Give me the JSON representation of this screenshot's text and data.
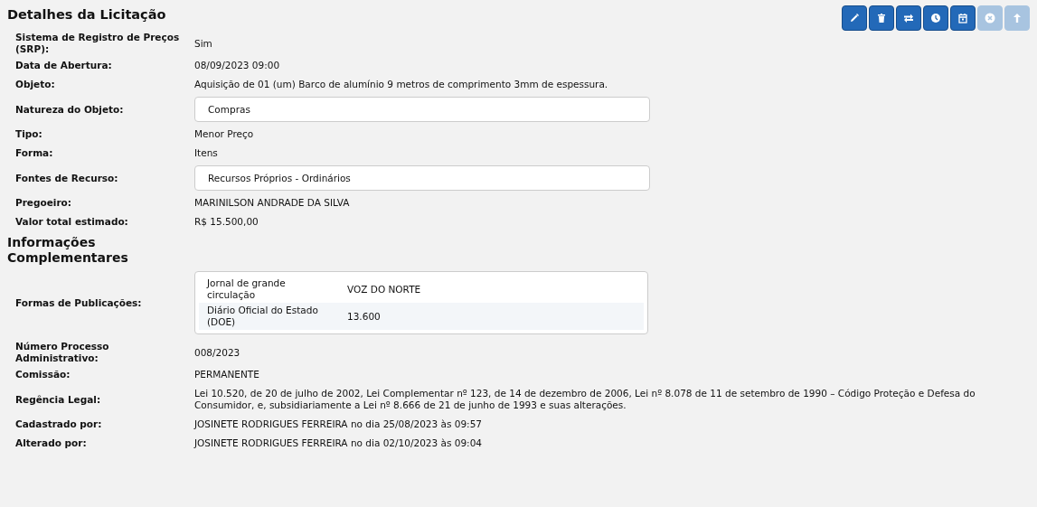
{
  "title": "Detalhes da Licitação",
  "toolbar": [
    {
      "kind": "pencil",
      "disabled": false
    },
    {
      "kind": "trash",
      "disabled": false
    },
    {
      "kind": "swap",
      "disabled": false
    },
    {
      "kind": "clock",
      "disabled": false
    },
    {
      "kind": "calendar",
      "disabled": false
    },
    {
      "kind": "cancel",
      "disabled": true
    },
    {
      "kind": "up",
      "disabled": true
    }
  ],
  "sections": [
    {
      "rows": [
        {
          "kind": "text",
          "label": "Sistema de Registro de Preços (SRP):",
          "value": "Sim"
        },
        {
          "kind": "text",
          "label": "Data de Abertura:",
          "value": "08/09/2023 09:00"
        },
        {
          "kind": "text",
          "label": "Objeto:",
          "value": "Aquisição de 01 (um) Barco de alumínio 9 metros de comprimento 3mm de espessura."
        },
        {
          "kind": "field",
          "label": "Natureza do Objeto:",
          "value": "Compras"
        },
        {
          "kind": "text",
          "label": "Tipo:",
          "value": "Menor Preço"
        },
        {
          "kind": "text",
          "label": "Forma:",
          "value": "Itens"
        },
        {
          "kind": "field",
          "label": "Fontes de Recurso:",
          "value": "Recursos Próprios - Ordinários"
        },
        {
          "kind": "text",
          "label": "Pregoeiro:",
          "value": "MARINILSON ANDRADE DA SILVA"
        },
        {
          "kind": "text",
          "label": "Valor total estimado:",
          "value": "R$ 15.500,00"
        }
      ]
    },
    {
      "heading": "Informações Complementares",
      "rows": [
        {
          "kind": "table",
          "label": "Formas de Publicações:",
          "table": [
            {
              "name": "Jornal de grande circulação",
              "value": "VOZ DO NORTE"
            },
            {
              "name": "Diário Oficial do Estado (DOE)",
              "value": "13.600"
            }
          ]
        },
        {
          "kind": "text",
          "label": "Número Processo Administrativo:",
          "value": "008/2023"
        },
        {
          "kind": "text",
          "label": "Comissão:",
          "value": "PERMANENTE"
        },
        {
          "kind": "text",
          "label": "Regência Legal:",
          "value": "Lei 10.520, de 20 de julho de 2002, Lei Complementar nº 123, de 14 de dezembro de 2006, Lei nº 8.078 de 11 de setembro de 1990 – Código Proteção e Defesa do Consumidor, e, subsidiariamente a Lei nº 8.666 de 21 de junho de 1993 e suas alterações."
        },
        {
          "kind": "text",
          "label": "Cadastrado por:",
          "value": "JOSINETE RODRIGUES FERREIRA no dia 25/08/2023 às 09:57"
        },
        {
          "kind": "text",
          "label": "Alterado por:",
          "value": "JOSINETE RODRIGUES FERREIRA no dia 02/10/2023 às 09:04"
        }
      ]
    }
  ]
}
